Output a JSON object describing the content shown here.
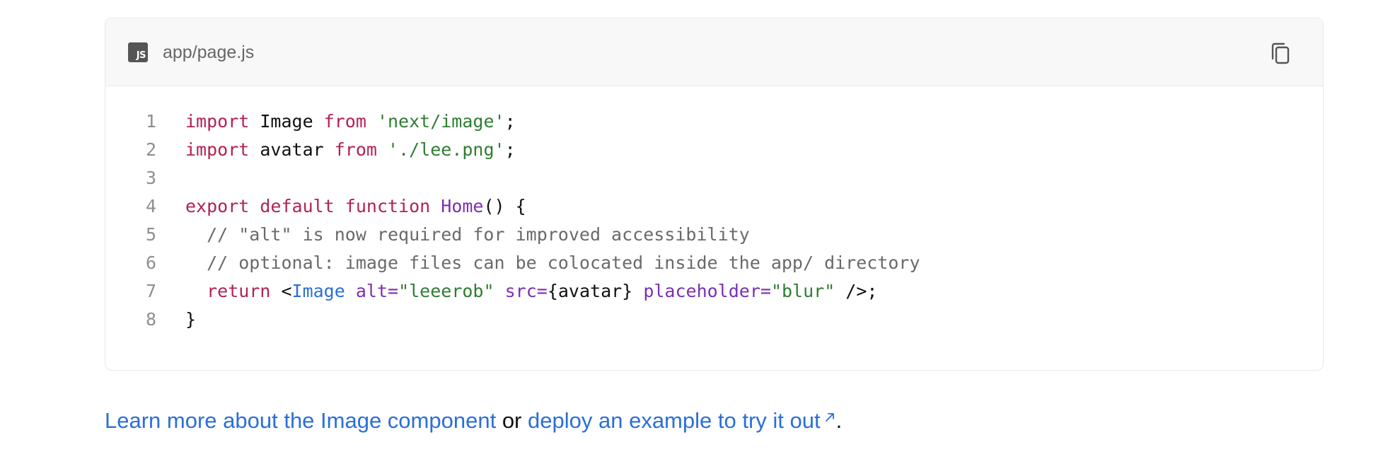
{
  "code_block": {
    "filename": "app/page.js",
    "language_badge": "JS",
    "copy_icon": "copy-icon",
    "lines": [
      {
        "number": "1",
        "tokens": [
          {
            "t": "import",
            "c": "kw"
          },
          {
            "t": " Image ",
            "c": "plain"
          },
          {
            "t": "from",
            "c": "kw"
          },
          {
            "t": " ",
            "c": "plain"
          },
          {
            "t": "'next/image'",
            "c": "str"
          },
          {
            "t": ";",
            "c": "plain"
          }
        ]
      },
      {
        "number": "2",
        "tokens": [
          {
            "t": "import",
            "c": "kw"
          },
          {
            "t": " avatar ",
            "c": "plain"
          },
          {
            "t": "from",
            "c": "kw"
          },
          {
            "t": " ",
            "c": "plain"
          },
          {
            "t": "'./lee.png'",
            "c": "str"
          },
          {
            "t": ";",
            "c": "plain"
          }
        ]
      },
      {
        "number": "3",
        "tokens": []
      },
      {
        "number": "4",
        "tokens": [
          {
            "t": "export",
            "c": "kw"
          },
          {
            "t": " ",
            "c": "plain"
          },
          {
            "t": "default",
            "c": "kw"
          },
          {
            "t": " ",
            "c": "plain"
          },
          {
            "t": "function",
            "c": "kw"
          },
          {
            "t": " ",
            "c": "plain"
          },
          {
            "t": "Home",
            "c": "fn"
          },
          {
            "t": "() {",
            "c": "plain"
          }
        ]
      },
      {
        "number": "5",
        "tokens": [
          {
            "t": "  // \"alt\" is now required for improved accessibility",
            "c": "com"
          }
        ]
      },
      {
        "number": "6",
        "tokens": [
          {
            "t": "  // optional: image files can be colocated inside the app/ directory",
            "c": "com"
          }
        ]
      },
      {
        "number": "7",
        "tokens": [
          {
            "t": "  ",
            "c": "plain"
          },
          {
            "t": "return",
            "c": "kw"
          },
          {
            "t": " <",
            "c": "plain"
          },
          {
            "t": "Image",
            "c": "tag"
          },
          {
            "t": " ",
            "c": "plain"
          },
          {
            "t": "alt=",
            "c": "attr"
          },
          {
            "t": "\"leeerob\"",
            "c": "str"
          },
          {
            "t": " ",
            "c": "plain"
          },
          {
            "t": "src=",
            "c": "attr"
          },
          {
            "t": "{avatar}",
            "c": "plain"
          },
          {
            "t": " ",
            "c": "plain"
          },
          {
            "t": "placeholder=",
            "c": "attr"
          },
          {
            "t": "\"blur\"",
            "c": "str"
          },
          {
            "t": " />;",
            "c": "plain"
          }
        ]
      },
      {
        "number": "8",
        "tokens": [
          {
            "t": "}",
            "c": "plain"
          }
        ]
      }
    ]
  },
  "footer": {
    "link_learn": "Learn more about the Image component",
    "connector": "or",
    "link_deploy": "deploy an example to try it out",
    "external_icon": "external-link-icon",
    "end": "."
  },
  "colors": {
    "keyword": "#b32350",
    "string": "#2f7d32",
    "function": "#7c2fb1",
    "tag": "#2a6fd8",
    "attribute": "#7c2fb1",
    "comment": "#6a6a6a",
    "link": "#2a6fd8"
  }
}
